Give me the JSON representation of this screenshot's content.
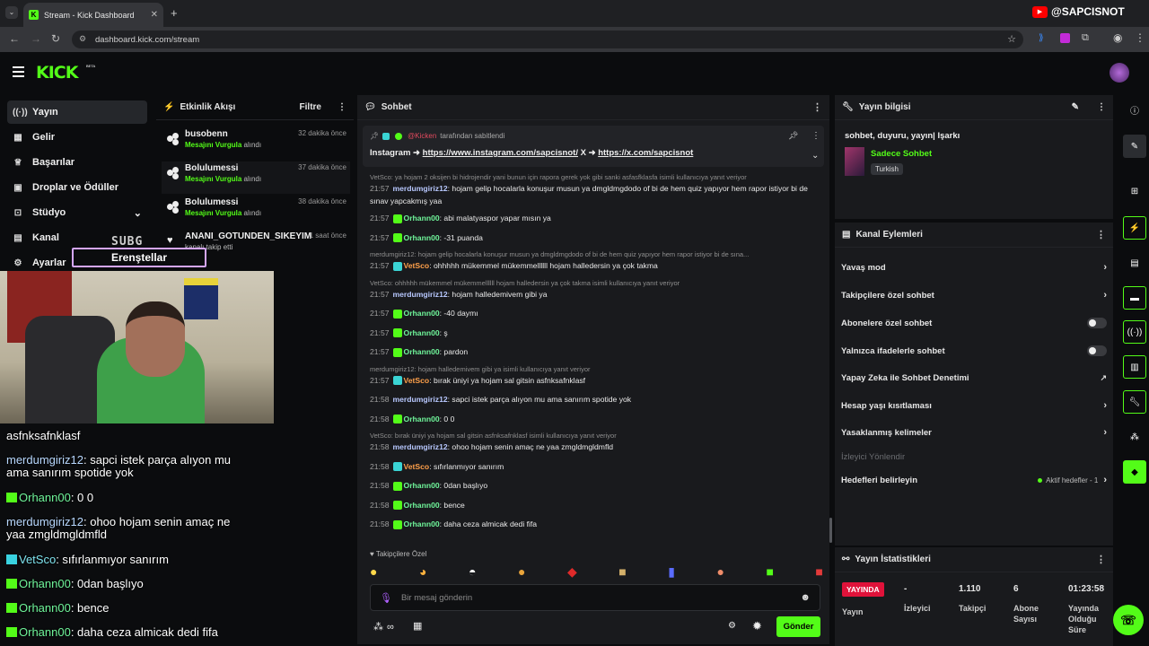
{
  "browser": {
    "tab_title": "Stream - Kick Dashboard",
    "url": "dashboard.kick.com/stream",
    "watermark": "@SAPCISNOT"
  },
  "kick": {
    "logo": "KICK",
    "beta": "BETA"
  },
  "sidebar": {
    "items": [
      {
        "label": "Yayın",
        "icon": "broadcast-icon"
      },
      {
        "label": "Gelir",
        "icon": "revenue-icon"
      },
      {
        "label": "Başarılar",
        "icon": "trophy-icon"
      },
      {
        "label": "Droplar ve Ödüller",
        "icon": "gift-icon"
      },
      {
        "label": "Stüdyo",
        "icon": "studio-icon"
      },
      {
        "label": "Kanal",
        "icon": "channel-icon"
      },
      {
        "label": "Ayarlar",
        "icon": "gear-icon"
      }
    ]
  },
  "activity": {
    "title": "Etkinlik Akışı",
    "filter": "Filtre",
    "items": [
      {
        "name": "busobenn",
        "sub": "Mesajını Vurgula",
        "sub2": "alındı",
        "time": "32 dakika önce"
      },
      {
        "name": "Bolulumessi",
        "sub": "Mesajını Vurgula",
        "sub2": "alındı",
        "time": "37 dakika önce"
      },
      {
        "name": "Bolulumessi",
        "sub": "Mesajını Vurgula",
        "sub2": "alındı",
        "time": "38 dakika önce"
      },
      {
        "name": "ANANI_GOTUNDEN_SIKEYIM",
        "sub": "",
        "sub2": "kanalı takip etti",
        "time": "1 saat önce"
      }
    ]
  },
  "overlay": {
    "sub_label": "SUBG",
    "sub_name": "Erenştellar",
    "chat": [
      {
        "user": "",
        "text": "asfnksafnklasf",
        "cls": ""
      },
      {
        "user": "merdumgiriz12",
        "text": ": sapci istek parça alıyon mu ama sanırım spotide yok",
        "cls": "u"
      },
      {
        "user": "Orhann00",
        "text": ": 0 0",
        "cls": "g"
      },
      {
        "user": "merdumgiriz12",
        "text": ": ohoo hojam senin amaç ne yaa zmgldmgldmfld",
        "cls": "u"
      },
      {
        "user": "VetSco",
        "text": ": sıfırlanmıyor sanırım",
        "cls": "c"
      },
      {
        "user": "Orhann00",
        "text": ": 0dan başlıyo",
        "cls": "g"
      },
      {
        "user": "Orhann00",
        "text": ": bence",
        "cls": "g"
      },
      {
        "user": "Orhann00",
        "text": ": daha ceza almicak dedi fifa",
        "cls": "g"
      }
    ]
  },
  "chat": {
    "title": "Sohbet",
    "pinned_by": "@Kicken",
    "pinned_suffix": "tarafından sabitlendi",
    "pinned_text_prefix": "Instagram ➜ ",
    "pinned_link1": "https://www.instagram.com/sapcisnot/",
    "pinned_mid": " X ➜ ",
    "pinned_link2": "https://x.com/sapcisnot",
    "messages": [
      {
        "reply": "VetSco: ya hojam 2 oksijen bi hidrojendir yani bunun için rapora gerek yok gibi sanki asfasfklasfa isimli kullanıcıya yanıt veriyor"
      },
      {
        "time": "21:57",
        "user": "merdumgiriz12",
        "color": "#b8c8ff",
        "badge": "",
        "text": ": hojam gelip hocalarla konuşur musun ya dmgldmgdodo of bi de hem quiz yapıyor hem rapor istiyor bi de sınav yapcakmış yaa"
      },
      {
        "time": "21:57",
        "user": "Orhann00",
        "color": "#6ff59a",
        "badge": "green",
        "text": ": abi malatyaspor yapar mısın ya"
      },
      {
        "time": "21:57",
        "user": "Orhann00",
        "color": "#6ff59a",
        "badge": "green",
        "text": ": -31 puanda"
      },
      {
        "reply": "merdumgiriz12: hojam gelip hocalarla konuşur musun ya dmgldmgdodo of bi de hem quiz yapıyor hem rapor istiyor bi de sına..."
      },
      {
        "time": "21:57",
        "user": "VetSco",
        "color": "#ffa04a",
        "badge": "blue",
        "text": ": ohhhhh mükemmel mükemmellllll hojam halledersin ya çok takma"
      },
      {
        "reply": "VetSco: ohhhhh mükemmel mükemmellllll hojam halledersin ya çok takma isimli kullanıcıya yanıt veriyor"
      },
      {
        "time": "21:57",
        "user": "merdumgiriz12",
        "color": "#b8c8ff",
        "badge": "",
        "text": ": hojam halledemivem gibi ya"
      },
      {
        "time": "21:57",
        "user": "Orhann00",
        "color": "#6ff59a",
        "badge": "green",
        "text": ": -40 daymı"
      },
      {
        "time": "21:57",
        "user": "Orhann00",
        "color": "#6ff59a",
        "badge": "green",
        "text": ": ş"
      },
      {
        "time": "21:57",
        "user": "Orhann00",
        "color": "#6ff59a",
        "badge": "green",
        "text": ": pardon"
      },
      {
        "reply": "merdumgiriz12: hojam halledemivem gibi ya isimli kullanıcıya yanıt veriyor"
      },
      {
        "time": "21:57",
        "user": "VetSco",
        "color": "#ffa04a",
        "badge": "blue",
        "text": ": bırak üniyi ya hojam sal gitsin asfnksafnklasf"
      },
      {
        "time": "21:58",
        "user": "merdumgiriz12",
        "color": "#b8c8ff",
        "badge": "",
        "text": ": sapci istek parça alıyon mu ama sanırım spotide yok"
      },
      {
        "time": "21:58",
        "user": "Orhann00",
        "color": "#6ff59a",
        "badge": "green",
        "text": ": 0 0"
      },
      {
        "reply": "VetSco: bırak üniyi ya hojam sal gitsin asfnksafnklasf isimli kullanıcıya yanıt veriyor"
      },
      {
        "time": "21:58",
        "user": "merdumgiriz12",
        "color": "#b8c8ff",
        "badge": "",
        "text": ": ohoo hojam senin amaç ne yaa zmgldmgldmfld"
      },
      {
        "time": "21:58",
        "user": "VetSco",
        "color": "#ffa04a",
        "badge": "blue",
        "text": ": sıfırlanmıyor sanırım"
      },
      {
        "time": "21:58",
        "user": "Orhann00",
        "color": "#6ff59a",
        "badge": "green",
        "text": ": 0dan başlıyo"
      },
      {
        "time": "21:58",
        "user": "Orhann00",
        "color": "#6ff59a",
        "badge": "green",
        "text": ": bence"
      },
      {
        "time": "21:58",
        "user": "Orhann00",
        "color": "#6ff59a",
        "badge": "green",
        "text": ": daha ceza almicak dedi fifa"
      }
    ],
    "followers_only_label": "Takipçilere Özel",
    "input_placeholder": "Bir mesaj gönderin",
    "infinity": "∞",
    "send": "Gönder"
  },
  "stream_info": {
    "title": "Yayın bilgisi",
    "stream_title": "sohbet, duyuru, yayın| Işarkı",
    "category": "Sadece Sohbet",
    "language": "Turkish"
  },
  "channel_actions": {
    "title": "Kanal Eylemleri",
    "rows": [
      {
        "label": "Yavaş mod",
        "control": "chevron"
      },
      {
        "label": "Takipçilere özel sohbet",
        "control": "chevron"
      },
      {
        "label": "Abonelere özel sohbet",
        "control": "toggle"
      },
      {
        "label": "Yalnızca ifadelerle sohbet",
        "control": "toggle"
      },
      {
        "label": "Yapay Zeka ile Sohbet Denetimi",
        "control": "chart"
      },
      {
        "label": "Hesap yaşı kısıtlaması",
        "control": "chevron"
      },
      {
        "label": "Yasaklanmış kelimeler",
        "control": "chevron"
      }
    ],
    "disabled_row": "İzleyici Yönlendir",
    "goals_label": "Hedefleri belirleyin",
    "goals_status": "Aktif hedefler - 1"
  },
  "stats": {
    "title": "Yayın İstatistikleri",
    "live_badge": "YAYINDA",
    "live_label": "Yayın",
    "viewers_value": "-",
    "viewers_label": "İzleyici",
    "followers_value": "1.110",
    "followers_label": "Takipçi",
    "subs_value": "6",
    "subs_label": "Abone Sayısı",
    "duration_value": "01:23:58",
    "duration_label": "Yayında Olduğu Süre"
  }
}
